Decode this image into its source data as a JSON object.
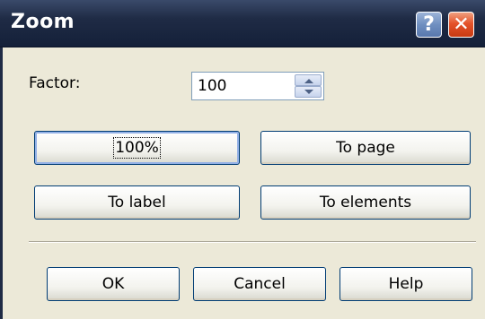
{
  "window": {
    "title": "Zoom",
    "help_glyph": "?",
    "close_glyph": "✕",
    "help_icon": "help-icon",
    "close_icon": "close-icon"
  },
  "factor": {
    "label": "Factor:",
    "value": "100"
  },
  "zoom_buttons": {
    "percent_label": "100%",
    "to_page_label": "To page",
    "to_label_label": "To label",
    "to_elements_label": "To elements"
  },
  "footer_buttons": {
    "ok_label": "OK",
    "cancel_label": "Cancel",
    "help_label": "Help"
  },
  "colors": {
    "titlebar": "#1f2b45",
    "dialog_bg": "#ece9d8",
    "close_button": "#e5532a"
  }
}
